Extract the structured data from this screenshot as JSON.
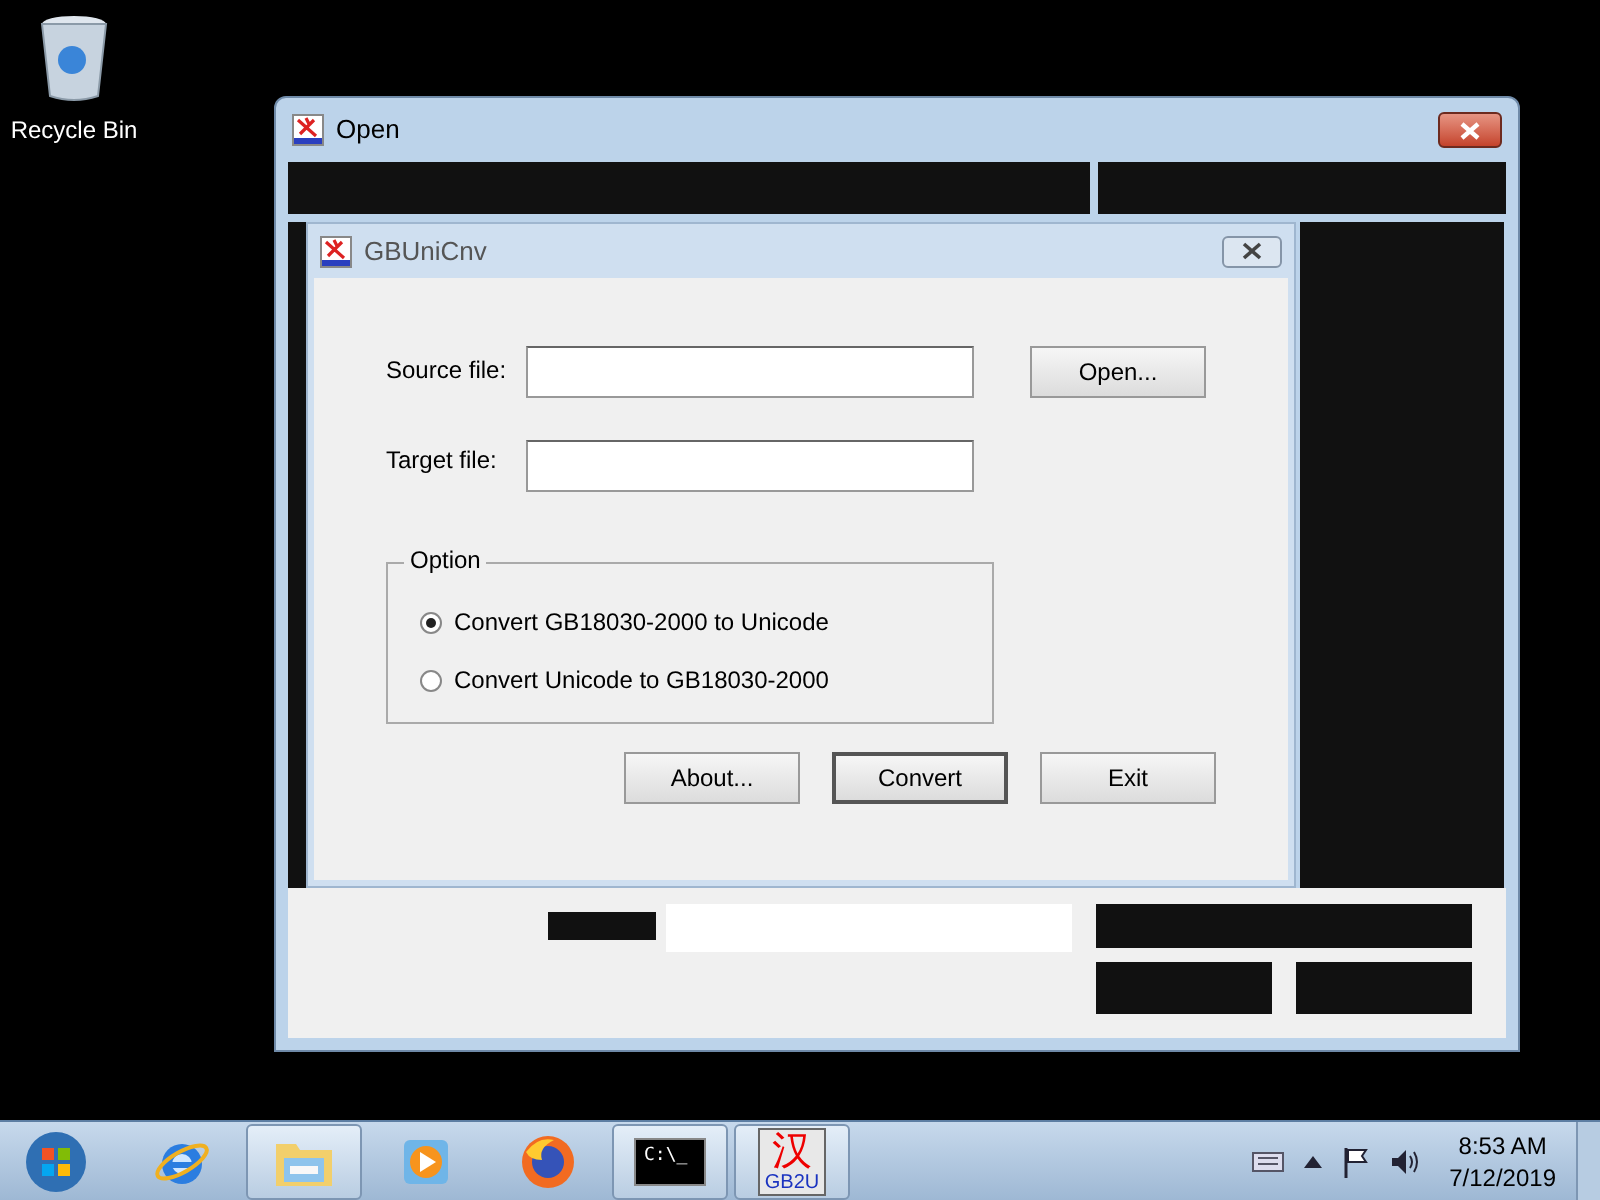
{
  "desktop": {
    "icons": [
      {
        "label": "Recycle Bin"
      }
    ]
  },
  "open_window": {
    "title": "Open"
  },
  "dialog": {
    "title": "GBUniCnv",
    "source_label": "Source file:",
    "target_label": "Target file:",
    "open_button": "Open...",
    "option_group": {
      "legend": "Option",
      "options": [
        {
          "label": "Convert GB18030-2000 to Unicode",
          "selected": true
        },
        {
          "label": "Convert Unicode to GB18030-2000",
          "selected": false
        }
      ]
    },
    "buttons": [
      {
        "label": "About...",
        "default": false
      },
      {
        "label": "Convert",
        "default": true
      },
      {
        "label": "Exit",
        "default": false
      }
    ]
  },
  "taskbar": {
    "items": [
      {
        "kind": "browser",
        "running": false
      },
      {
        "kind": "folder",
        "running": true
      },
      {
        "kind": "media",
        "running": false
      },
      {
        "kind": "firefox",
        "running": false
      },
      {
        "kind": "console",
        "running": true,
        "text": "C:\\_"
      },
      {
        "kind": "converter",
        "running": true,
        "glyph": "汉",
        "caption": "GB2U"
      }
    ],
    "time": "8:53 AM",
    "date": "7/12/2019"
  }
}
